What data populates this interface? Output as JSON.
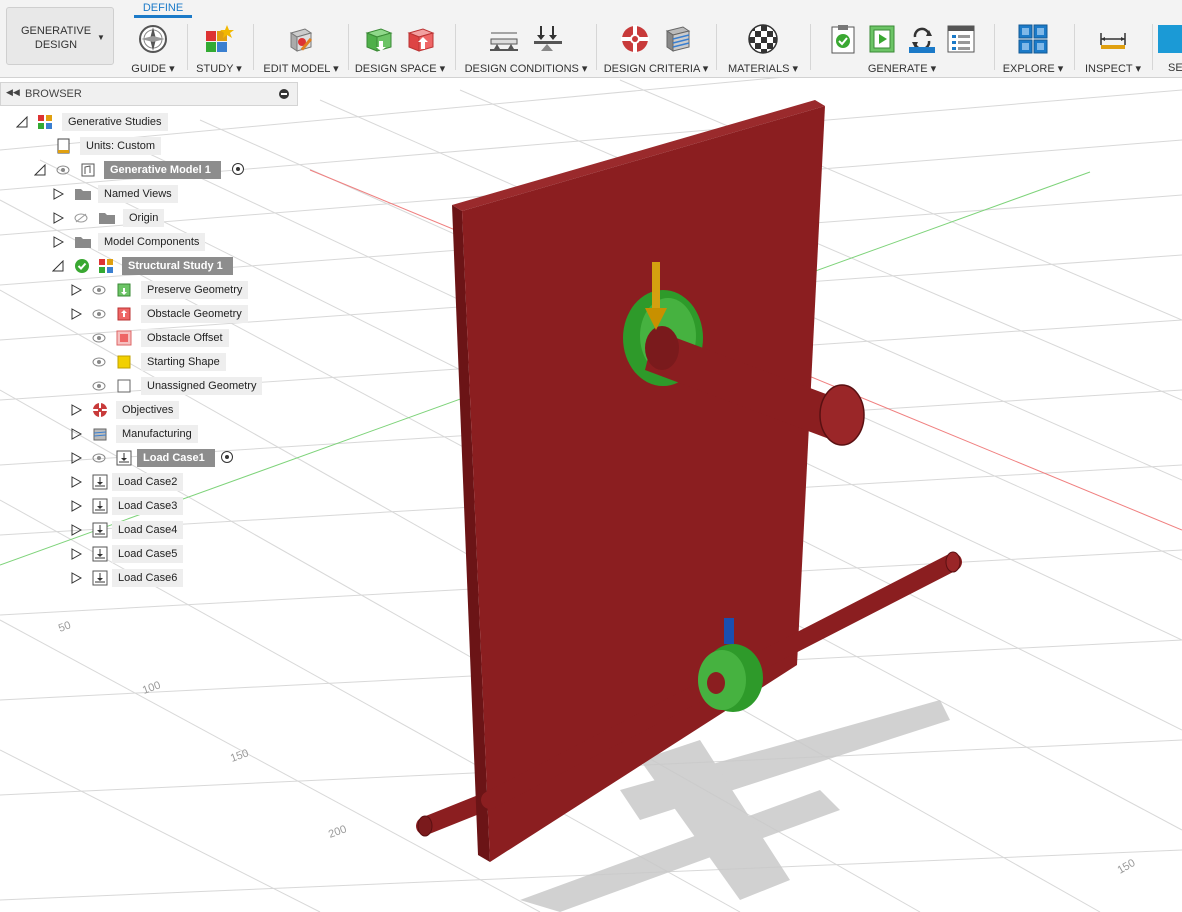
{
  "workspace": {
    "line1": "GENERATIVE",
    "line2": "DESIGN"
  },
  "active_tab": "DEFINE",
  "toolbar_groups": [
    {
      "label": "GUIDE"
    },
    {
      "label": "STUDY"
    },
    {
      "label": "EDIT MODEL"
    },
    {
      "label": "DESIGN SPACE"
    },
    {
      "label": "DESIGN CONDITIONS"
    },
    {
      "label": "DESIGN CRITERIA"
    },
    {
      "label": "MATERIALS"
    },
    {
      "label": "GENERATE"
    },
    {
      "label": "EXPLORE"
    },
    {
      "label": "INSPECT"
    },
    {
      "label": "SE"
    }
  ],
  "browser": {
    "title": "BROWSER",
    "items": [
      {
        "label": "Generative Studies"
      },
      {
        "label": "Units: Custom"
      },
      {
        "label": "Generative Model 1"
      },
      {
        "label": "Named Views"
      },
      {
        "label": "Origin"
      },
      {
        "label": "Model Components"
      },
      {
        "label": "Structural Study 1"
      },
      {
        "label": "Preserve Geometry"
      },
      {
        "label": "Obstacle Geometry"
      },
      {
        "label": "Obstacle Offset"
      },
      {
        "label": "Starting Shape"
      },
      {
        "label": "Unassigned Geometry"
      },
      {
        "label": "Objectives"
      },
      {
        "label": "Manufacturing"
      },
      {
        "label": "Load Case1"
      },
      {
        "label": "Load Case2"
      },
      {
        "label": "Load Case3"
      },
      {
        "label": "Load Case4"
      },
      {
        "label": "Load Case5"
      },
      {
        "label": "Load Case6"
      }
    ]
  },
  "ruler_labels": [
    "50",
    "100",
    "150",
    "200",
    "150"
  ],
  "colors": {
    "accent": "#1b7ac8",
    "obstacle": "#8b1e20",
    "preserve": "#3aa832",
    "load_arrow": "#d4a010",
    "constraint_arrow": "#1a4fb0"
  }
}
